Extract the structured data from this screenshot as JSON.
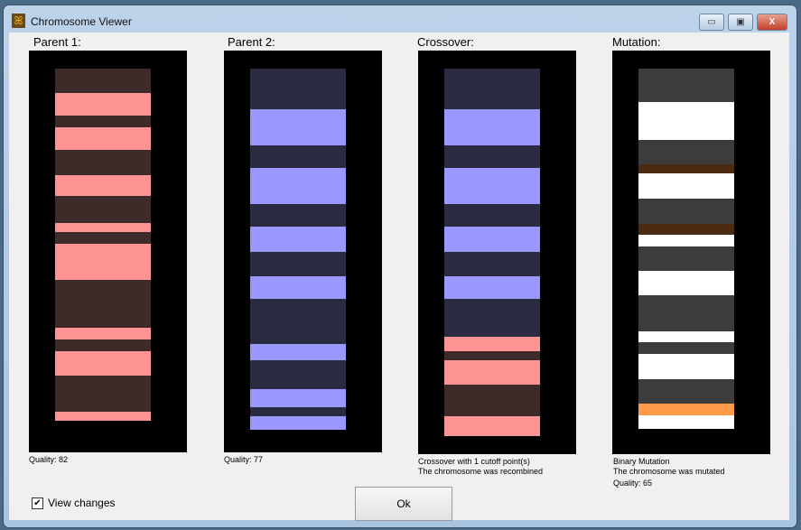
{
  "window": {
    "title": "Chromosome Viewer",
    "minimize": "▭",
    "maximize": "▣",
    "close": "X"
  },
  "colors": {
    "p_light": "#ff9494",
    "p_dark": "#3f2a2a",
    "b_light": "#9a98ff",
    "b_dark": "#2a2a40",
    "w": "#ffffff",
    "g": "#3c3c3c",
    "br": "#4a2a10",
    "or": "#ff9a48"
  },
  "panels": [
    {
      "label": "Parent 1:",
      "lines": [
        "Quality: 82"
      ],
      "bands": [
        [
          "p_dark",
          27
        ],
        [
          "p_light",
          25
        ],
        [
          "p_dark",
          13
        ],
        [
          "p_light",
          25
        ],
        [
          "p_dark",
          28
        ],
        [
          "p_light",
          23
        ],
        [
          "p_dark",
          30
        ],
        [
          "p_light",
          10
        ],
        [
          "p_dark",
          13
        ],
        [
          "p_light",
          40
        ],
        [
          "p_dark",
          53
        ],
        [
          "p_light",
          13
        ],
        [
          "p_dark",
          13
        ],
        [
          "p_light",
          27
        ],
        [
          "p_dark",
          40
        ],
        [
          "p_light",
          10
        ]
      ]
    },
    {
      "label": "Parent 2:",
      "lines": [
        "Quality: 77"
      ],
      "bands": [
        [
          "b_dark",
          45
        ],
        [
          "b_light",
          40
        ],
        [
          "b_dark",
          25
        ],
        [
          "b_light",
          40
        ],
        [
          "b_dark",
          25
        ],
        [
          "b_light",
          28
        ],
        [
          "b_dark",
          27
        ],
        [
          "b_light",
          25
        ],
        [
          "b_dark",
          50
        ],
        [
          "b_light",
          18
        ],
        [
          "b_dark",
          32
        ],
        [
          "b_light",
          20
        ],
        [
          "b_dark",
          10
        ],
        [
          "b_light",
          15
        ]
      ]
    },
    {
      "label": "Crossover:",
      "lines": [
        "Crossover with 1 cutoff point(s)",
        "The chromosome was recombined"
      ],
      "bands": [
        [
          "b_dark",
          45
        ],
        [
          "b_light",
          40
        ],
        [
          "b_dark",
          25
        ],
        [
          "b_light",
          40
        ],
        [
          "b_dark",
          25
        ],
        [
          "b_light",
          28
        ],
        [
          "b_dark",
          27
        ],
        [
          "b_light",
          25
        ],
        [
          "b_dark",
          42
        ],
        [
          "p_light",
          16
        ],
        [
          "p_dark",
          10
        ],
        [
          "p_light",
          27
        ],
        [
          "p_dark",
          35
        ],
        [
          "p_light",
          22
        ]
      ]
    },
    {
      "label": "Mutation:",
      "lines": [
        "Binary Mutation",
        "The chromosome was mutated",
        "Quality: 65"
      ],
      "bands": [
        [
          "g",
          37
        ],
        [
          "w",
          42
        ],
        [
          "g",
          27
        ],
        [
          "br",
          10
        ],
        [
          "w",
          28
        ],
        [
          "g",
          28
        ],
        [
          "br",
          12
        ],
        [
          "w",
          13
        ],
        [
          "g",
          27
        ],
        [
          "w",
          27
        ],
        [
          "g",
          40
        ],
        [
          "w",
          12
        ],
        [
          "g",
          13
        ],
        [
          "w",
          28
        ],
        [
          "g",
          27
        ],
        [
          "or",
          13
        ],
        [
          "w",
          15
        ]
      ]
    }
  ],
  "footer": {
    "checkbox_label": "View changes",
    "checkbox_checked": true,
    "check_mark": "✔",
    "ok_label": "Ok"
  }
}
